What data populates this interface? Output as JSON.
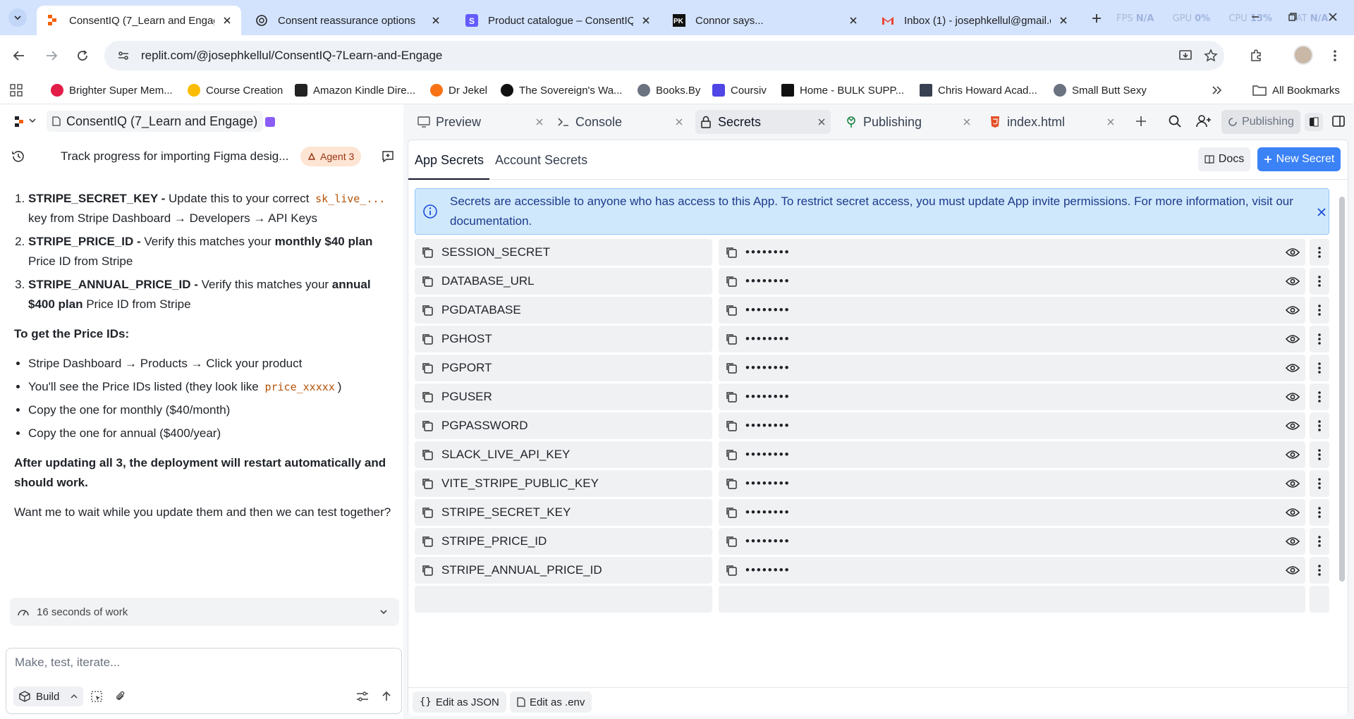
{
  "browser": {
    "tabs": [
      {
        "title": "ConsentIQ (7_Learn and Engage",
        "active": true,
        "favicon": "replit-icon"
      },
      {
        "title": "Consent reassurance options",
        "active": false,
        "favicon": "chatgpt-icon"
      },
      {
        "title": "Product catalogue – ConsentIQ",
        "active": false,
        "favicon": "stripe-icon"
      },
      {
        "title": "Connor says...",
        "active": false,
        "favicon": "pk-icon"
      },
      {
        "title": "Inbox (1) - josephkellul@gmail.c",
        "active": false,
        "favicon": "gmail-icon"
      }
    ],
    "perf_labels": {
      "fps": "FPS",
      "fps_val": "N/A",
      "gpu": "GPU",
      "gpu_val": "0%",
      "cpu": "CPU",
      "cpu_val": "13%",
      "lat": "LAT",
      "lat_val": "N/A"
    },
    "url": "replit.com/@josephkellul/ConsentIQ-7Learn-and-Engage",
    "bookmarks": [
      {
        "label": "Brighter Super Mem...",
        "color": "#e11d48"
      },
      {
        "label": "Course Creation",
        "color": "#fbbc04"
      },
      {
        "label": "Amazon Kindle Dire...",
        "color": "#222222"
      },
      {
        "label": "Dr Jekel",
        "color": "#f97316"
      },
      {
        "label": "The Sovereign's Wa...",
        "color": "#111111"
      },
      {
        "label": "Books.By",
        "color": "#6b7280"
      },
      {
        "label": "Coursiv",
        "color": "#4f46e5"
      },
      {
        "label": "Home - BULK SUPP...",
        "color": "#111111"
      },
      {
        "label": "Chris Howard Acad...",
        "color": "#374151"
      },
      {
        "label": "Small Butt Sexy",
        "color": "#6b7280"
      }
    ],
    "all_bookmarks": "All Bookmarks"
  },
  "left": {
    "project_name": "ConsentIQ (7_Learn and Engage)",
    "thread_title": "Track progress for importing Figma desig...",
    "agent_badge": "Agent 3",
    "chat": {
      "item1_key": "STRIPE_SECRET_KEY -",
      "item1_text_a": " Update this to your correct ",
      "item1_code": "sk_live_...",
      "item1_text_b": " key from Stripe Dashboard → Developers → API Keys",
      "item2_key": "STRIPE_PRICE_ID -",
      "item2_text_a": " Verify this matches your ",
      "item2_bold": "monthly $40 plan",
      "item2_text_b": " Price ID from Stripe",
      "item3_key": "STRIPE_ANNUAL_PRICE_ID -",
      "item3_text_a": " Verify this matches your ",
      "item3_bold": "annual $400 plan",
      "item3_text_b": " Price ID from Stripe",
      "heading": "To get the Price IDs:",
      "bullet1": "Stripe Dashboard → Products → Click your product",
      "bullet2_a": "You'll see the Price IDs listed (they look like ",
      "bullet2_code": "price_xxxxx",
      "bullet2_b": ")",
      "bullet3": "Copy the one for monthly ($40/month)",
      "bullet4": "Copy the one for annual ($400/year)",
      "bold_para": "After updating all 3, the deployment will restart automatically and should work.",
      "final_para": "Want me to wait while you update them and then we can test together?"
    },
    "work_summary": "16 seconds of work",
    "composer_placeholder": "Make, test, iterate...",
    "build_label": "Build"
  },
  "right": {
    "tabs": [
      {
        "label": "Preview",
        "icon": "monitor-icon"
      },
      {
        "label": "Console",
        "icon": "terminal-icon"
      },
      {
        "label": "Secrets",
        "icon": "lock-icon"
      },
      {
        "label": "Publishing",
        "icon": "publish-icon"
      },
      {
        "label": "index.html",
        "icon": "html-icon"
      }
    ],
    "publishing_button": "Publishing",
    "secrets": {
      "tab_app": "App Secrets",
      "tab_account": "Account Secrets",
      "docs_label": "Docs",
      "new_secret_label": "New Secret",
      "info_text": "Secrets are accessible to anyone who has access to this App. To restrict secret access, you must update App invite permissions. For more information, visit ",
      "info_link": "our documentation",
      "info_end": ".",
      "masked_value": "••••••••",
      "keys": [
        "SESSION_SECRET",
        "DATABASE_URL",
        "PGDATABASE",
        "PGHOST",
        "PGPORT",
        "PGUSER",
        "PGPASSWORD",
        "SLACK_LIVE_API_KEY",
        "VITE_STRIPE_PUBLIC_KEY",
        "STRIPE_SECRET_KEY",
        "STRIPE_PRICE_ID",
        "STRIPE_ANNUAL_PRICE_ID"
      ],
      "edit_json": "Edit as JSON",
      "edit_env": "Edit as .env"
    }
  },
  "colors": {
    "accent": "#3b82f6",
    "info_bg": "#cfe8fc",
    "badge_bg": "#fde4d3"
  }
}
